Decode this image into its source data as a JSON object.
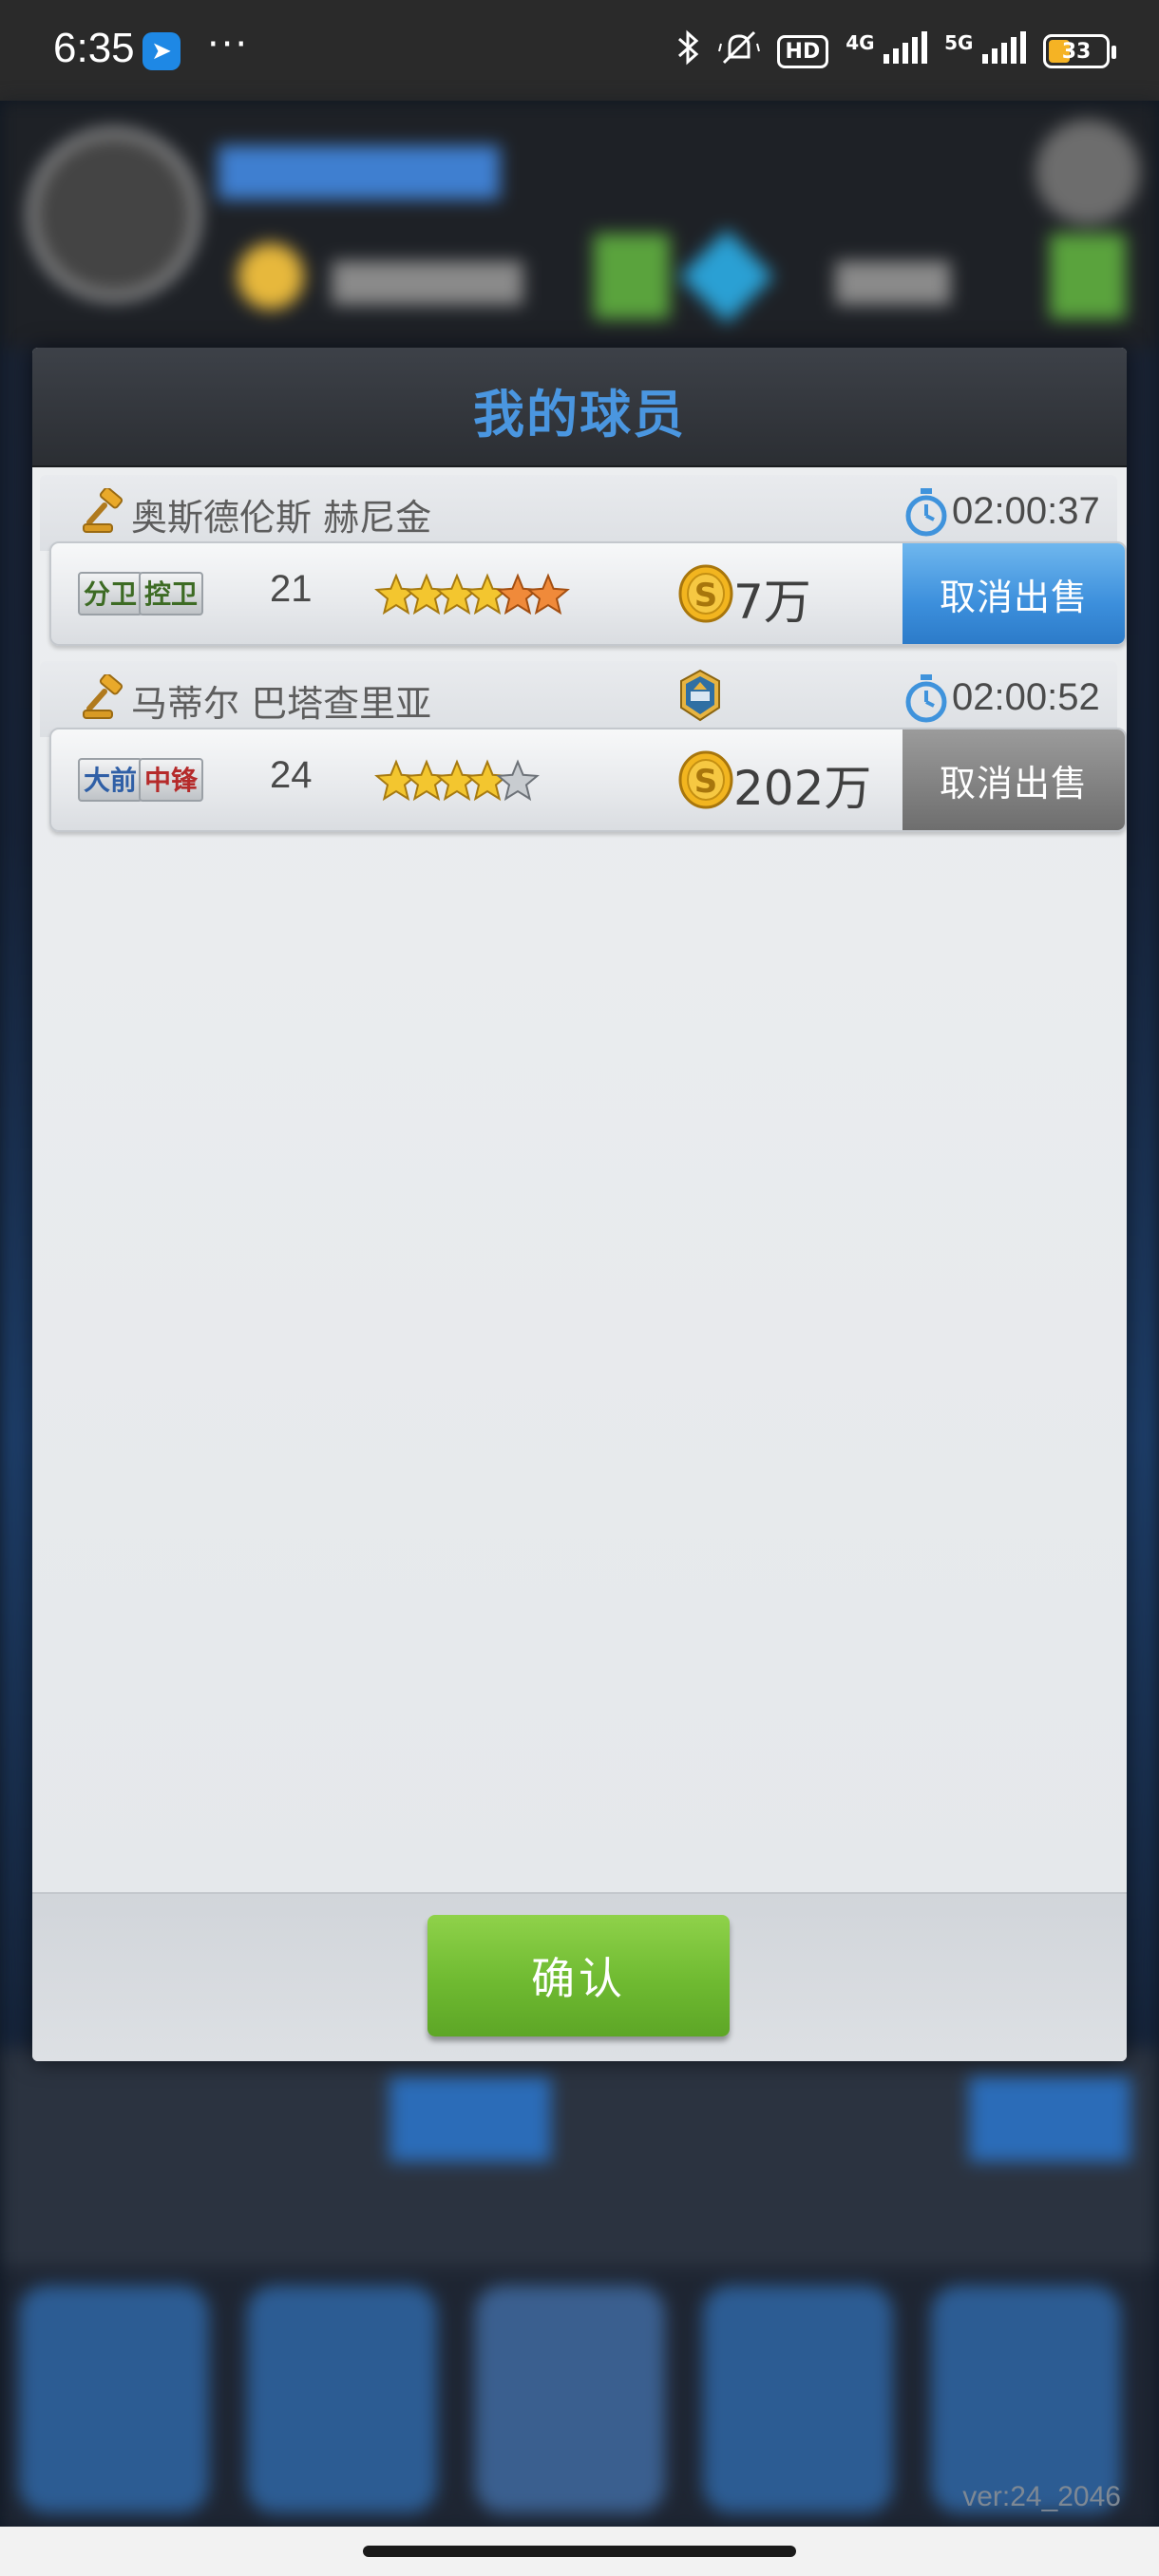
{
  "status_bar": {
    "time": "6:35",
    "app_icon_glyph": "➤",
    "overflow": "···",
    "hd_label": "HD",
    "net_4g": "4G",
    "net_5g": "5G",
    "battery_level": "33"
  },
  "background": {
    "version": "ver:24_2046"
  },
  "dialog": {
    "title": "我的球员",
    "confirm_label": "确认",
    "players": [
      {
        "name": "奥斯德伦斯 赫尼金",
        "timer": "02:00:37",
        "positions": [
          "分卫",
          "控卫"
        ],
        "age": "21",
        "star_rating": 5,
        "price": "7万",
        "cancel_label": "取消出售",
        "cancel_color": "#3c8fdc"
      },
      {
        "name": "马蒂尔 巴塔查里亚",
        "timer": "02:00:52",
        "positions": [
          "大前",
          "中锋"
        ],
        "age": "24",
        "star_rating": 4.5,
        "price": "202万",
        "cancel_label": "取消出售",
        "cancel_color": "#808080"
      }
    ]
  },
  "colors": {
    "title_blue": "#4a96e0",
    "confirm_green": "#6fba31",
    "star_gold": "#f3c62f",
    "star_orange": "#f08a3a"
  },
  "icons": [
    "gavel-icon",
    "timer-icon",
    "coin-icon",
    "star-icon",
    "club-badge-icon"
  ]
}
